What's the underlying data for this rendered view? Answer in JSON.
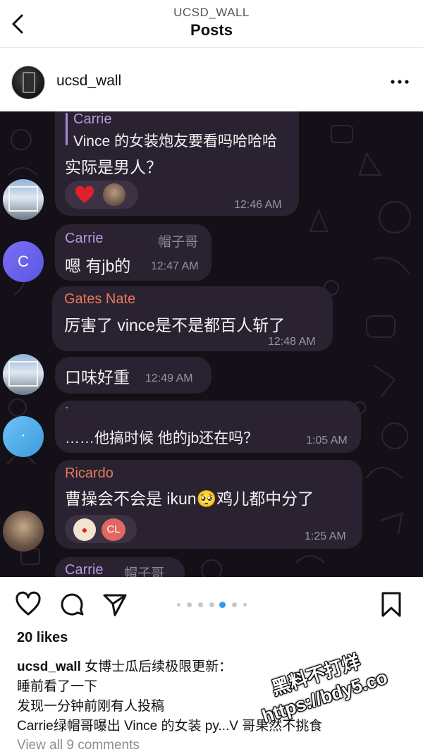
{
  "topbar": {
    "account": "UCSD_WALL",
    "title": "Posts"
  },
  "post": {
    "username": "ucsd_wall"
  },
  "chat": [
    {
      "quote_sender": "Carrie",
      "quote_text": "Vince 的女装炮友要看吗哈哈哈",
      "text": "实际是男人？",
      "time": "12:46 AM",
      "reactions": [
        "heart",
        "avatar"
      ]
    },
    {
      "sender": "Carrie",
      "role": "帽子哥",
      "text": "嗯 有jb的",
      "time": "12:47 AM",
      "avatar_letter": "C"
    },
    {
      "sender": "Gates Nate",
      "text": "厉害了 vince是不是都百人斩了",
      "time": "12:48 AM"
    },
    {
      "text": "口味好重",
      "time": "12:49 AM"
    },
    {
      "sender": ".",
      "text": "……他搞时候 他的jb还在吗？",
      "time": "1:05 AM"
    },
    {
      "sender": "Ricardo",
      "text": "曹操会不会是 ikun🥺鸡儿都中分了",
      "time": "1:25 AM",
      "reactions": [
        "clown",
        "CL"
      ]
    },
    {
      "sender": "Carrie",
      "role": "帽子哥"
    }
  ],
  "actions": {
    "like": "heart-icon",
    "comment": "comment-icon",
    "share": "share-icon",
    "save": "bookmark-icon",
    "carousel_index": 3,
    "carousel_total": 6
  },
  "likes": "20 likes",
  "caption": {
    "username": "ucsd_wall",
    "lines": [
      "女博士瓜后续极限更新：",
      "睡前看了一下",
      "发现一分钟前刚有人投稿",
      "Carrie绿帽哥曝出 Vince 的女装 py...V 哥果然不挑食"
    ]
  },
  "view_all": "View all 9 comments",
  "watermark": {
    "line1": "黑料不打烊",
    "line2": "https://bdy5.co"
  },
  "colors": {
    "chat_bg": "#141017",
    "bubble": "#2a2230",
    "carrie": "#b39be0",
    "gates": "#e8795a",
    "ricardo": "#e57a5e",
    "dot_sender": "#5db7e8",
    "carousel_active": "#3897f0"
  }
}
